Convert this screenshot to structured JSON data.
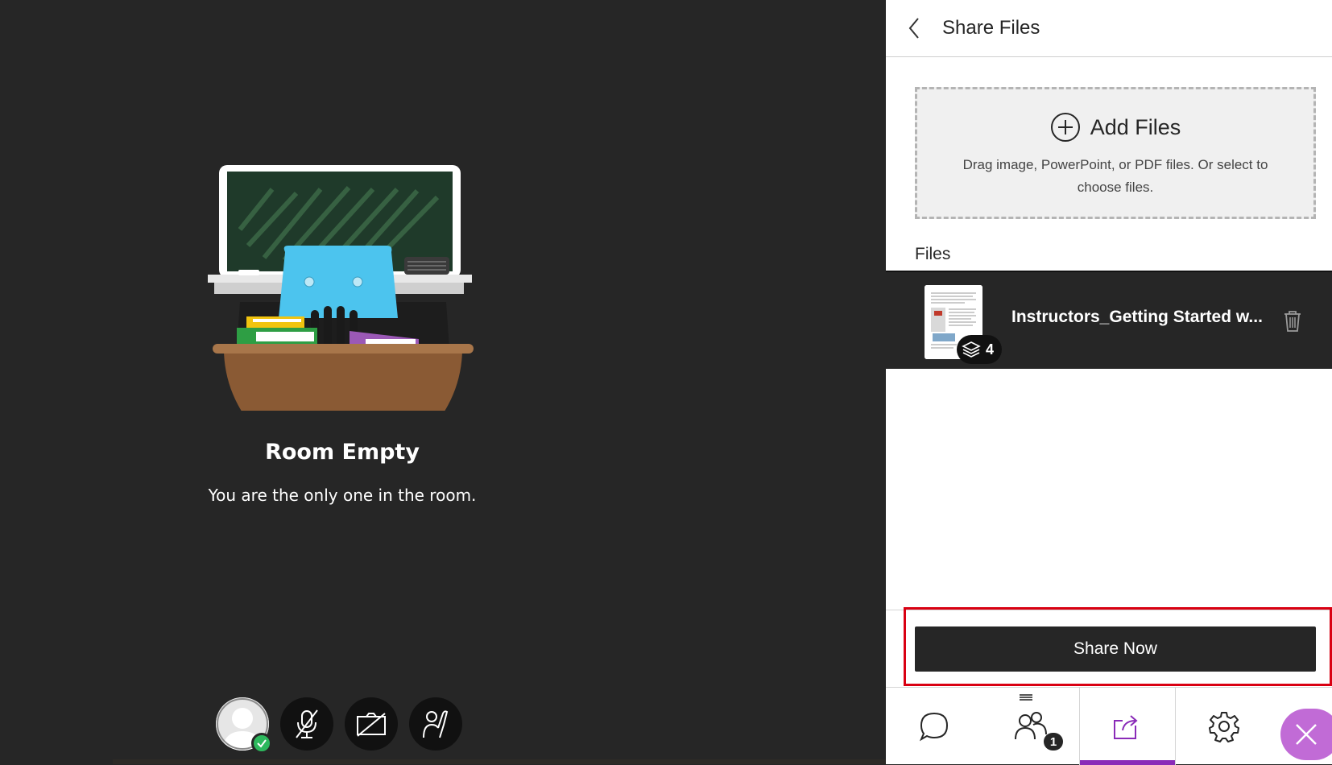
{
  "room": {
    "title": "Room Empty",
    "subtitle": "You are the only one in the room."
  },
  "controls": {
    "avatar_status": "available",
    "items": [
      "avatar",
      "microphone-muted",
      "camera-off",
      "raise-hand"
    ]
  },
  "panel": {
    "title": "Share Files",
    "add_files_label": "Add Files",
    "drop_hint": "Drag image, PowerPoint, or PDF files. Or select to choose files.",
    "files_heading": "Files",
    "files": [
      {
        "name": "Instructors_Getting Started w...",
        "pages": "4"
      }
    ],
    "share_button": "Share Now"
  },
  "tabs": {
    "people_count": "1",
    "active": "share-content"
  },
  "colors": {
    "stage_bg": "#262626",
    "accent_purple": "#8a2bb8",
    "close_purple": "#c16bd6",
    "highlight_red": "#d90012",
    "status_green": "#2db85d"
  }
}
